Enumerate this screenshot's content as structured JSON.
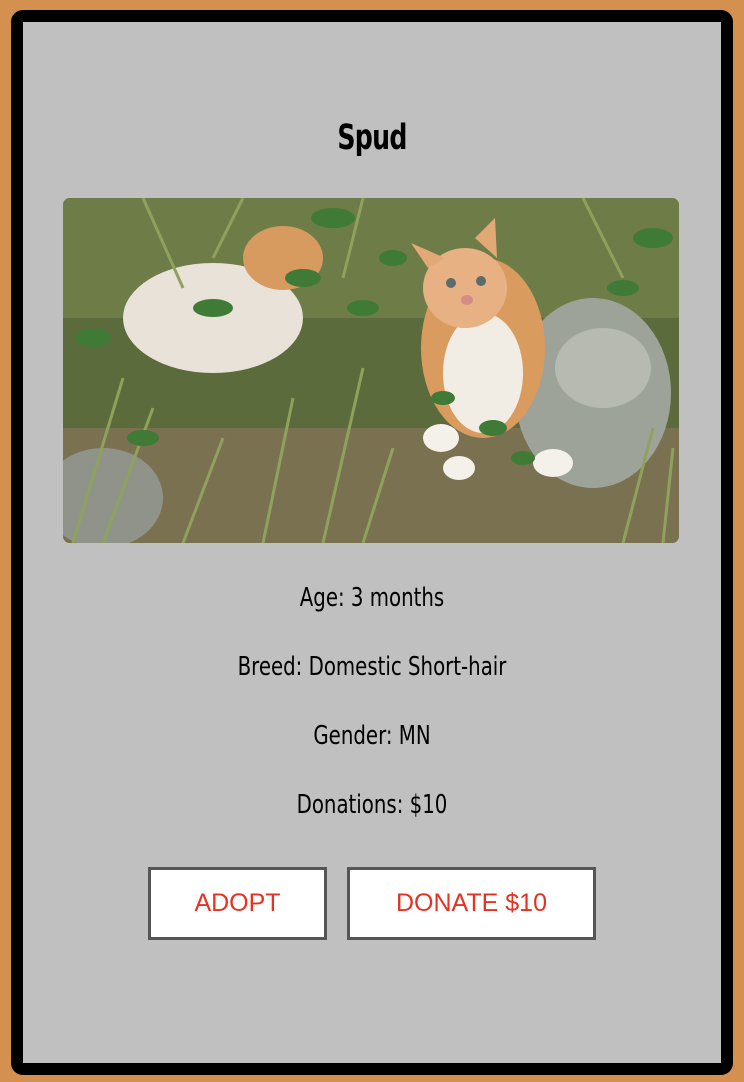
{
  "pet": {
    "name": "Spud",
    "photo_alt": "two orange and white kittens in grass",
    "details": [
      {
        "label": "Age:",
        "value": "3 months"
      },
      {
        "label": "Breed:",
        "value": "Domestic Short-hair"
      },
      {
        "label": "Gender:",
        "value": "MN"
      },
      {
        "label": "Donations:",
        "value": "$10"
      }
    ]
  },
  "actions": {
    "adopt_label": "ADOPT",
    "donate_label": "DONATE $10"
  },
  "colors": {
    "page_background": "#d3904f",
    "card_background": "#c0c0c0",
    "card_border": "#000000",
    "button_text": "#e63222"
  }
}
